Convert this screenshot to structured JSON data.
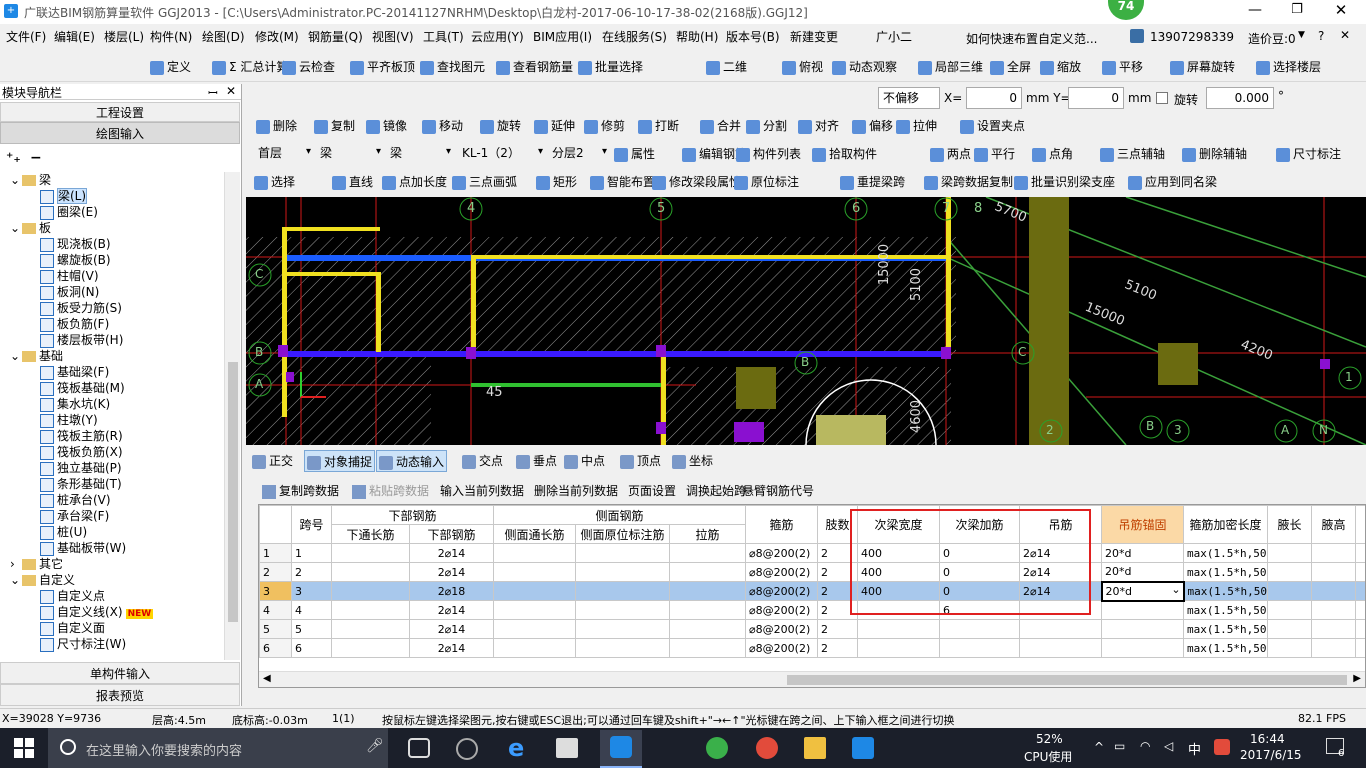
{
  "title": "广联达BIM钢筋算量软件 GGJ2013 - [C:\\Users\\Administrator.PC-20141127NRHM\\Desktop\\白龙村-2017-06-10-17-38-02(2168版).GGJ12]",
  "notif_badge": "74",
  "menu": [
    "文件(F)",
    "编辑(E)",
    "楼层(L)",
    "构件(N)",
    "绘图(D)",
    "修改(M)",
    "钢筋量(Q)",
    "视图(V)",
    "工具(T)",
    "云应用(Y)",
    "BIM应用(I)",
    "在线服务(S)",
    "帮助(H)",
    "版本号(B)",
    "新建变更",
    "广小二"
  ],
  "menu_help_text": "如何快速布置自定义范...",
  "user_phone": "13907298339",
  "cost_beans": "造价豆:0",
  "toolbar1": [
    "定义",
    "Σ 汇总计算",
    "云检查",
    "平齐板顶",
    "查找图元",
    "查看钢筋量",
    "批量选择",
    "二维",
    "俯视",
    "动态观察",
    "局部三维",
    "全屏",
    "缩放",
    "平移",
    "屏幕旋转",
    "选择楼层"
  ],
  "left_panel": {
    "title": "模块导航栏",
    "pin": "ꟷ",
    "btn_project": "工程设置",
    "btn_draw": "绘图输入",
    "btn_single": "单构件输入",
    "btn_report": "报表预览"
  },
  "tree": [
    {
      "label": "梁",
      "type": "folder",
      "level": 1
    },
    {
      "label": "梁(L)",
      "type": "item",
      "level": 2,
      "selected": true
    },
    {
      "label": "圈梁(E)",
      "type": "item",
      "level": 2
    },
    {
      "label": "板",
      "type": "folder",
      "level": 1
    },
    {
      "label": "现浇板(B)",
      "type": "item",
      "level": 2
    },
    {
      "label": "螺旋板(B)",
      "type": "item",
      "level": 2
    },
    {
      "label": "柱帽(V)",
      "type": "item",
      "level": 2
    },
    {
      "label": "板洞(N)",
      "type": "item",
      "level": 2
    },
    {
      "label": "板受力筋(S)",
      "type": "item",
      "level": 2
    },
    {
      "label": "板负筋(F)",
      "type": "item",
      "level": 2
    },
    {
      "label": "楼层板带(H)",
      "type": "item",
      "level": 2
    },
    {
      "label": "基础",
      "type": "folder",
      "level": 1
    },
    {
      "label": "基础梁(F)",
      "type": "item",
      "level": 2
    },
    {
      "label": "筏板基础(M)",
      "type": "item",
      "level": 2
    },
    {
      "label": "集水坑(K)",
      "type": "item",
      "level": 2
    },
    {
      "label": "柱墩(Y)",
      "type": "item",
      "level": 2
    },
    {
      "label": "筏板主筋(R)",
      "type": "item",
      "level": 2
    },
    {
      "label": "筏板负筋(X)",
      "type": "item",
      "level": 2
    },
    {
      "label": "独立基础(P)",
      "type": "item",
      "level": 2
    },
    {
      "label": "条形基础(T)",
      "type": "item",
      "level": 2
    },
    {
      "label": "桩承台(V)",
      "type": "item",
      "level": 2
    },
    {
      "label": "承台梁(F)",
      "type": "item",
      "level": 2
    },
    {
      "label": "桩(U)",
      "type": "item",
      "level": 2
    },
    {
      "label": "基础板带(W)",
      "type": "item",
      "level": 2
    },
    {
      "label": "其它",
      "type": "folder",
      "level": 1,
      "collapsed": true
    },
    {
      "label": "自定义",
      "type": "folder",
      "level": 1
    },
    {
      "label": "自定义点",
      "type": "item",
      "level": 2
    },
    {
      "label": "自定义线(X)",
      "type": "item",
      "level": 2,
      "badge": "NEW"
    },
    {
      "label": "自定义面",
      "type": "item",
      "level": 2
    },
    {
      "label": "尺寸标注(W)",
      "type": "item",
      "level": 2
    }
  ],
  "offset_row": {
    "mode": "不偏移",
    "x_label": "X=",
    "x": "0",
    "y_label": "mm Y=",
    "y": "0",
    "mm": "mm",
    "rotate_label": "旋转",
    "rotate": "0.000",
    "deg": "°"
  },
  "tb_edit": [
    "删除",
    "复制",
    "镜像",
    "移动",
    "旋转",
    "延伸",
    "修剪",
    "打断",
    "合并",
    "分割",
    "对齐",
    "偏移",
    "拉伸",
    "设置夹点"
  ],
  "tb_layer": {
    "floor": "首层",
    "cat": "梁",
    "sub": "梁",
    "comp": "KL-1（2）",
    "layer": "分层2",
    "items": [
      "属性",
      "编辑钢筋",
      "构件列表",
      "拾取构件",
      "两点",
      "平行",
      "点角",
      "三点辅轴",
      "删除辅轴",
      "尺寸标注"
    ]
  },
  "tb_draw": [
    "选择",
    "直线",
    "点加长度",
    "三点画弧",
    "矩形",
    "智能布置",
    "修改梁段属性",
    "原位标注",
    "重提梁跨",
    "梁跨数据复制",
    "批量识别梁支座",
    "应用到同名梁"
  ],
  "canvas_labels": {
    "axis_top": [
      "4",
      "5",
      "6",
      "7",
      "8"
    ],
    "dims": [
      "5700",
      "5100",
      "15000",
      "4200",
      "15000",
      "5100",
      "4600",
      "1500"
    ],
    "left_axes": [
      "C",
      "B",
      "A"
    ],
    "bottom_axes": [
      "B",
      "C",
      "2",
      "B",
      "3",
      "A",
      "N",
      "1"
    ],
    "cross_label": "45"
  },
  "snap": [
    "正交",
    "对象捕捉",
    "动态输入",
    "交点",
    "垂点",
    "中点",
    "顶点",
    "坐标"
  ],
  "grid_toolbar": [
    "复制跨数据",
    "粘贴跨数据",
    "输入当前列数据",
    "删除当前列数据",
    "页面设置",
    "调换起始跨",
    "悬臂钢筋代号"
  ],
  "grid": {
    "group_headers": {
      "span": "跨号",
      "bottom": "下部钢筋",
      "side": "侧面钢筋",
      "stirrup": "箍筋",
      "legs": "肢数",
      "sec_width": "次梁宽度",
      "sec_add": "次梁加筋",
      "hanger": "吊筋",
      "hanger_anchor": "吊筋锚固",
      "dense_len": "箍筋加密长度",
      "haunch_len": "腋长",
      "haunch_h": "腋高"
    },
    "sub_headers": [
      "下通长筋",
      "下部钢筋",
      "侧面通长筋",
      "侧面原位标注筋",
      "拉筋"
    ],
    "rows": [
      {
        "n": "1",
        "span": "1",
        "bottom": "2⌀14",
        "stirrup": "⌀8@200(2)",
        "legs": "2",
        "sec_width": "400",
        "sec_add": "0",
        "hanger": "2⌀14",
        "anchor": "20*d",
        "dense": "max(1.5*h,50"
      },
      {
        "n": "2",
        "span": "2",
        "bottom": "2⌀14",
        "stirrup": "⌀8@200(2)",
        "legs": "2",
        "sec_width": "400",
        "sec_add": "0",
        "hanger": "2⌀14",
        "anchor": "20*d",
        "dense": "max(1.5*h,50"
      },
      {
        "n": "3",
        "span": "3",
        "bottom": "2⌀18",
        "stirrup": "⌀8@200(2)",
        "legs": "2",
        "sec_width": "400",
        "sec_add": "0",
        "hanger": "2⌀14",
        "anchor": "20*d",
        "dense": "max(1.5*h,50",
        "selected": true
      },
      {
        "n": "4",
        "span": "4",
        "bottom": "2⌀14",
        "stirrup": "⌀8@200(2)",
        "legs": "2",
        "sec_width": "",
        "sec_add": "6",
        "hanger": "",
        "anchor": "",
        "dense": "max(1.5*h,50"
      },
      {
        "n": "5",
        "span": "5",
        "bottom": "2⌀14",
        "stirrup": "⌀8@200(2)",
        "legs": "2",
        "sec_width": "",
        "sec_add": "",
        "hanger": "",
        "anchor": "",
        "dense": "max(1.5*h,50"
      },
      {
        "n": "6",
        "span": "6",
        "bottom": "2⌀14",
        "stirrup": "⌀8@200(2)",
        "legs": "2",
        "sec_width": "",
        "sec_add": "",
        "hanger": "",
        "anchor": "",
        "dense": "max(1.5*h,50"
      }
    ]
  },
  "status": {
    "coords": "X=39028 Y=9736",
    "floor_h": "层高:4.5m",
    "base_h": "底标高:-0.03m",
    "count": "1(1)",
    "hint": "按鼠标左键选择梁图元,按右键或ESC退出;可以通过回车键及shift+\"→←↑\"光标键在跨之间、上下输入框之间进行切换",
    "fps": "82.1 FPS"
  },
  "taskbar": {
    "search": "在这里输入你要搜索的内容",
    "cpu_pct": "52%",
    "cpu_label": "CPU使用",
    "ime": "中",
    "time": "16:44",
    "date": "2017/6/15",
    "notif": "6"
  }
}
